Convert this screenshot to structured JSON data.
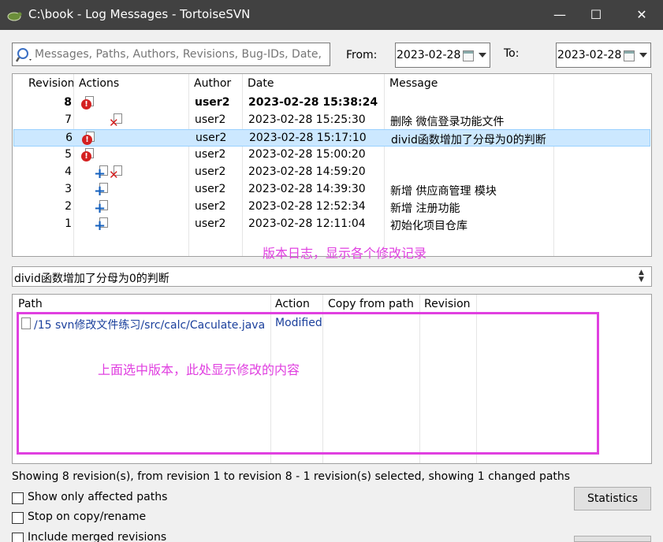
{
  "window": {
    "title": "C:\\book - Log Messages - TortoiseSVN",
    "app_icon": "tortoise-icon",
    "controls": [
      "minimize",
      "maximize",
      "close"
    ]
  },
  "search": {
    "placeholder": "Messages, Paths, Authors, Revisions, Bug-IDs, Date,",
    "value": "",
    "icon": "search-icon"
  },
  "filter": {
    "from_label": "From:",
    "from_date": "2023-02-28",
    "to_label": "To:",
    "to_date": "2023-02-28"
  },
  "log_table": {
    "columns": [
      "Revision",
      "Actions",
      "Author",
      "Date",
      "Message"
    ],
    "rows": [
      {
        "revision": "8",
        "actions": [
          "modified"
        ],
        "author": "user2",
        "date": "2023-02-28 15:38:24",
        "message": "",
        "bold": true,
        "selected": false
      },
      {
        "revision": "7",
        "actions": [
          "deleted"
        ],
        "author": "user2",
        "date": "2023-02-28 15:25:30",
        "message": "删除 微信登录功能文件",
        "bold": false,
        "selected": false
      },
      {
        "revision": "6",
        "actions": [
          "modified"
        ],
        "author": "user2",
        "date": "2023-02-28 15:17:10",
        "message": "divid函数增加了分母为0的判断",
        "bold": false,
        "selected": true
      },
      {
        "revision": "5",
        "actions": [
          "modified"
        ],
        "author": "user2",
        "date": "2023-02-28 15:00:20",
        "message": "",
        "bold": false,
        "selected": false
      },
      {
        "revision": "4",
        "actions": [
          "added",
          "deleted"
        ],
        "author": "user2",
        "date": "2023-02-28 14:59:20",
        "message": "",
        "bold": false,
        "selected": false
      },
      {
        "revision": "3",
        "actions": [
          "added"
        ],
        "author": "user2",
        "date": "2023-02-28 14:39:30",
        "message": "新增 供应商管理 模块",
        "bold": false,
        "selected": false
      },
      {
        "revision": "2",
        "actions": [
          "added"
        ],
        "author": "user2",
        "date": "2023-02-28 12:52:34",
        "message": "新增 注册功能",
        "bold": false,
        "selected": false
      },
      {
        "revision": "1",
        "actions": [
          "added"
        ],
        "author": "user2",
        "date": "2023-02-28 12:11:04",
        "message": "初始化项目仓库",
        "bold": false,
        "selected": false
      }
    ]
  },
  "annotations": {
    "log": "版本日志，显示各个修改记录",
    "paths": "上面选中版本，此处显示修改的内容"
  },
  "message_detail": {
    "text": "divid函数增加了分母为0的判断"
  },
  "paths_table": {
    "columns": [
      "Path",
      "Action",
      "Copy from path",
      "Revision"
    ],
    "rows": [
      {
        "path": "/15 svn修改文件练习/src/calc/Caculate.java",
        "action": "Modified",
        "copy_from": "",
        "revision": ""
      }
    ]
  },
  "status": "Showing 8 revision(s), from revision 1 to revision 8 - 1 revision(s) selected, showing 1 changed paths",
  "options": [
    {
      "label": "Show only affected paths",
      "checked": false
    },
    {
      "label": "Stop on copy/rename",
      "checked": false
    },
    {
      "label": "Include merged revisions",
      "checked": false
    }
  ],
  "buttons": {
    "statistics": "Statistics"
  },
  "colors": {
    "titlebar": "#414141",
    "selection": "#cce8ff",
    "annotation": "#e040e0",
    "error_badge": "#d42020",
    "add_icon": "#1560bd",
    "path_text": "#1a3f9c"
  }
}
